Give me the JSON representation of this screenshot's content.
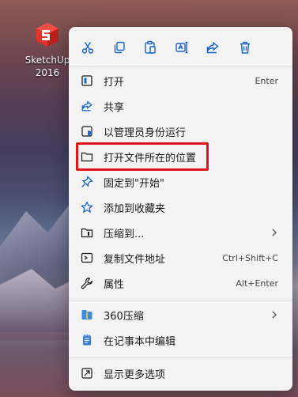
{
  "desktop": {
    "icon_label_line1": "SketchUp",
    "icon_label_line2": "2016"
  },
  "toolbar": {
    "icons": [
      "cut-icon",
      "copy-icon",
      "paste-icon",
      "rename-icon",
      "share-icon",
      "delete-icon"
    ],
    "accent": "#1a64c8"
  },
  "menu": {
    "items": [
      {
        "label": "打开",
        "shortcut": "Enter",
        "icon": "open-icon"
      },
      {
        "label": "共享",
        "shortcut": "",
        "icon": "share-icon"
      },
      {
        "label": "以管理员身份运行",
        "shortcut": "",
        "icon": "shield-icon"
      },
      {
        "label": "打开文件所在的位置",
        "shortcut": "",
        "icon": "folder-icon"
      },
      {
        "label": "固定到\"开始\"",
        "shortcut": "",
        "icon": "pin-icon"
      },
      {
        "label": "添加到收藏夹",
        "shortcut": "",
        "icon": "star-icon"
      },
      {
        "label": "压缩到...",
        "shortcut": "",
        "icon": "compress-icon",
        "submenu": true
      },
      {
        "label": "复制文件地址",
        "shortcut": "Ctrl+Shift+C",
        "icon": "copy-path-icon"
      },
      {
        "label": "属性",
        "shortcut": "Alt+Enter",
        "icon": "wrench-icon"
      },
      {
        "label": "360压缩",
        "shortcut": "",
        "icon": "archive-360-icon",
        "submenu": true
      },
      {
        "label": "在记事本中编辑",
        "shortcut": "",
        "icon": "notepad-icon"
      },
      {
        "label": "显示更多选项",
        "shortcut": "",
        "icon": "more-options-icon"
      }
    ]
  },
  "highlight_color": "#e1141b"
}
